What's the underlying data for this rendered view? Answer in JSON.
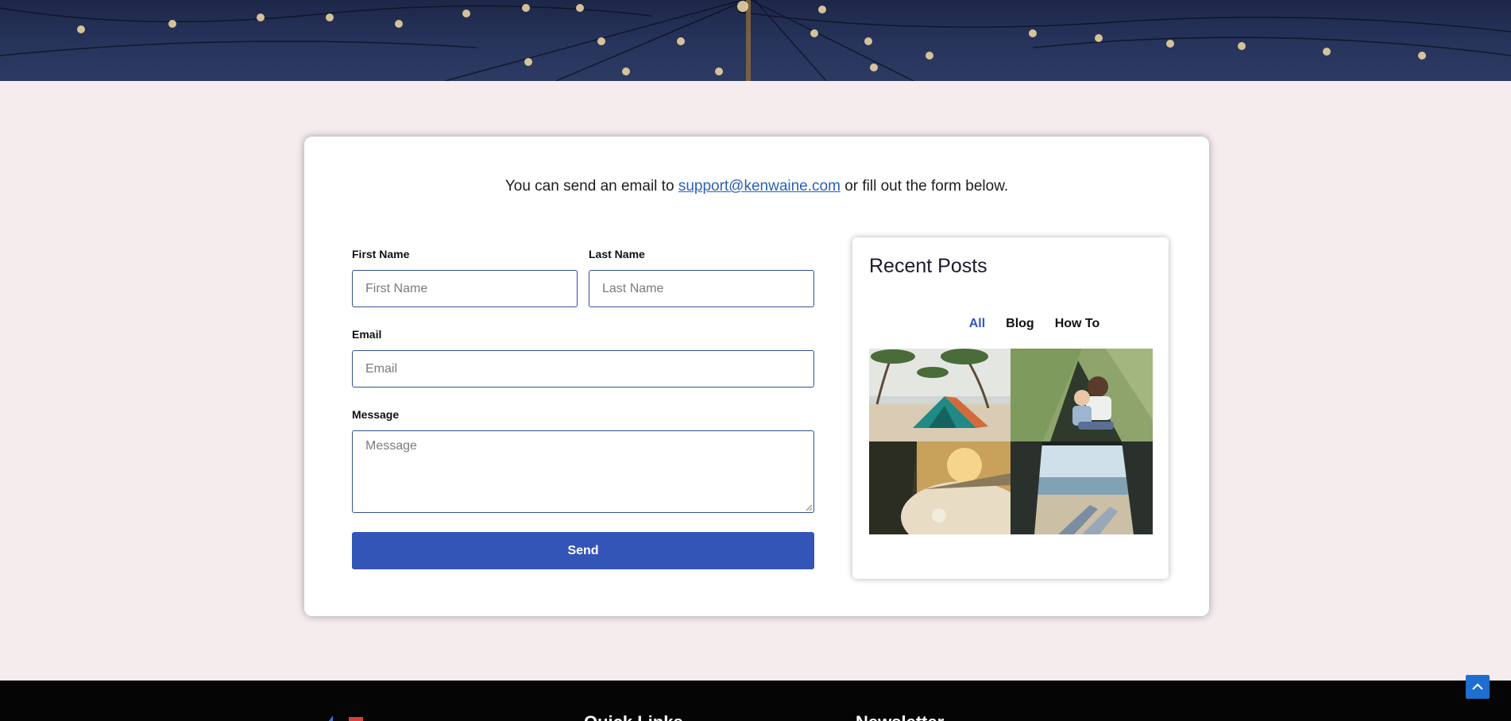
{
  "contact": {
    "intro_before": "You can send an email to",
    "email_link": "support@kenwaine.com",
    "intro_after": "or fill out the form below.",
    "first_name_label": "First Name",
    "first_name_placeholder": "First Name",
    "last_name_label": "Last Name",
    "last_name_placeholder": "Last Name",
    "email_label": "Email",
    "email_placeholder": "Email",
    "message_label": "Message",
    "message_placeholder": "Message",
    "send_label": "Send"
  },
  "recent_posts": {
    "title": "Recent Posts",
    "filters": [
      {
        "label": "All",
        "active": true
      },
      {
        "label": "Blog",
        "active": false
      },
      {
        "label": "How To",
        "active": false
      }
    ],
    "thumbnails": [
      "beach-tent-photo",
      "family-tent-photo",
      "sleeping-bag-photo",
      "tent-view-photo"
    ]
  },
  "footer": {
    "quick_links_heading": "Quick Links",
    "newsletter_heading": "Newsletter"
  },
  "colors": {
    "accent": "#3455b8",
    "page_bg": "#f5ecee",
    "footer_bg": "#050505",
    "link": "#2a62b8"
  },
  "icons": {
    "back_to_top": "chevron-up-icon"
  }
}
